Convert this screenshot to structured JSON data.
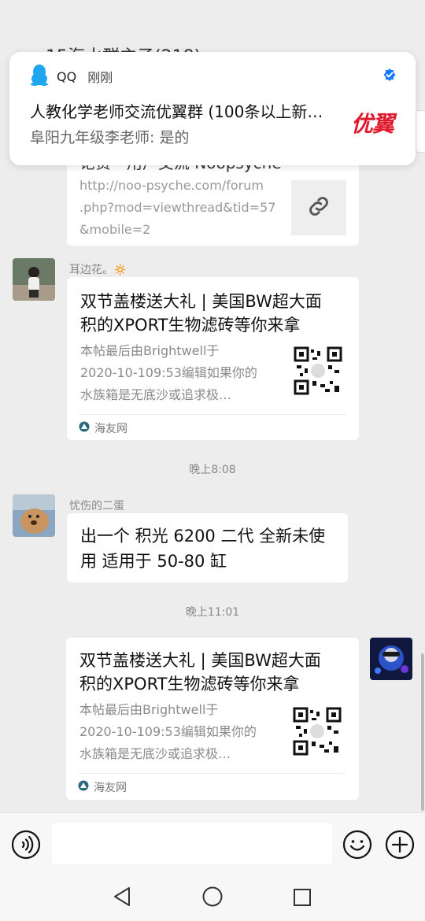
{
  "notification": {
    "app_name": "QQ",
    "time": "刚刚",
    "title": "人教化学老师交流优翼群 (100条以上新…",
    "body": "阜阳九年级李老师: 是的",
    "logo_text": "优翼"
  },
  "chat": {
    "title_peek": "15海水群主子(218)",
    "link_card_partial": {
      "title_tail": "论贤 - 用户交流 Noopsyche",
      "url": "http://noo-psyche.com/forum.php?mod=viewthread&tid=57&mobile=2",
      "url_lines": [
        "http://noo-psyche.com/forum",
        ".php?mod=viewthread&tid=57",
        "&mobile=2"
      ]
    },
    "messages": [
      {
        "sender": "耳边花。🔅",
        "card_title_lines": [
          "双节盖楼送大礼 | 美国BW超大面",
          "积的XPORT生物滤砖等你来拿"
        ],
        "card_desc_lines": [
          "本帖最后由Brightwell于",
          "2020-10-109:53编辑如果你的",
          "水族箱是无底沙或追求极…"
        ],
        "source": "海友网"
      },
      {
        "time_separator": "晚上8:08"
      },
      {
        "sender": "忧伤的二蛋",
        "text_lines": [
          "出一个 积光 6200 二代 全新未使",
          "用 适用于 50-80 缸"
        ]
      },
      {
        "time_separator": "晚上11:01"
      },
      {
        "sender": "",
        "card_title_lines": [
          "双节盖楼送大礼 | 美国BW超大面",
          "积的XPORT生物滤砖等你来拿"
        ],
        "card_desc_lines": [
          "本帖最后由Brightwell于",
          "2020-10-109:53编辑如果你的",
          "水族箱是无底沙或追求极…"
        ],
        "source": "海友网"
      }
    ]
  },
  "input": {
    "placeholder": ""
  },
  "icons": {
    "voice": "voice-icon",
    "emoji": "emoji-icon",
    "plus": "plus-icon",
    "back": "nav-back-icon",
    "home": "nav-home-icon",
    "recents": "nav-recents-icon",
    "link": "link-icon",
    "verified": "verified-check-icon"
  },
  "colors": {
    "background": "#ededed",
    "bubble": "#ffffff",
    "qq_blue": "#1ea7f0",
    "logo_red": "#e0182b",
    "verified_blue": "#1677ff"
  }
}
